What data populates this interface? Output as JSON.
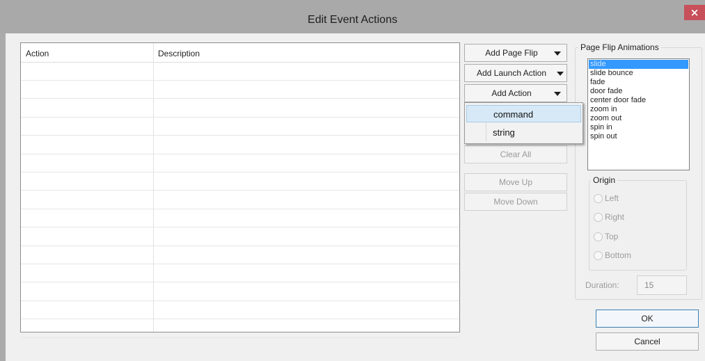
{
  "window": {
    "title": "Edit Event Actions",
    "close_glyph": "×"
  },
  "grid": {
    "columns": [
      "Action",
      "Description"
    ],
    "rows": 15
  },
  "buttons": {
    "add_page_flip": "Add Page Flip",
    "add_launch_action": "Add Launch Action",
    "add_action": "Add Action",
    "clear_all": "Clear All",
    "move_up": "Move Up",
    "move_down": "Move Down",
    "ok": "OK",
    "cancel": "Cancel"
  },
  "add_action_menu": {
    "items": [
      "command",
      "string"
    ],
    "hovered_index": 0
  },
  "page_flip": {
    "group_label": "Page Flip Animations",
    "animations": [
      "slide",
      "slide bounce",
      "fade",
      "door fade",
      "center door fade",
      "zoom in",
      "zoom out",
      "spin in",
      "spin out"
    ],
    "selected_index": 0,
    "origin": {
      "label": "Origin",
      "options": [
        "Left",
        "Right",
        "Top",
        "Bottom"
      ]
    },
    "duration_label": "Duration:",
    "duration_value": "15"
  },
  "colors": {
    "title_bar": "#a9a9a9",
    "close_button": "#c7505b",
    "selection": "#3399ff",
    "menu_hover": "#d7e9f7"
  },
  "icons": [
    "close-icon",
    "dropdown-arrow-icon"
  ]
}
